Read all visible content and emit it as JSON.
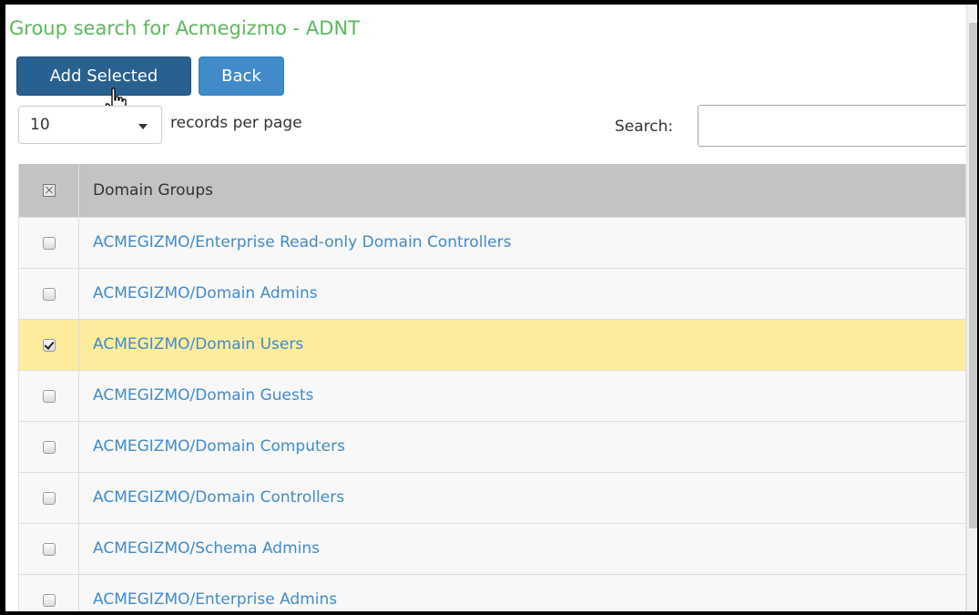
{
  "page": {
    "title": "Group search for Acmegizmo - ADNT"
  },
  "toolbar": {
    "add_selected_label": "Add Selected",
    "back_label": "Back"
  },
  "paging": {
    "length_value": "10",
    "records_label": "records per page"
  },
  "search": {
    "label": "Search:",
    "value": ""
  },
  "table": {
    "header": "Domain Groups",
    "rows": [
      {
        "name": "ACMEGIZMO/Enterprise Read-only Domain Controllers",
        "checked": false
      },
      {
        "name": "ACMEGIZMO/Domain Admins",
        "checked": false
      },
      {
        "name": "ACMEGIZMO/Domain Users",
        "checked": true
      },
      {
        "name": "ACMEGIZMO/Domain Guests",
        "checked": false
      },
      {
        "name": "ACMEGIZMO/Domain Computers",
        "checked": false
      },
      {
        "name": "ACMEGIZMO/Domain Controllers",
        "checked": false
      },
      {
        "name": "ACMEGIZMO/Schema Admins",
        "checked": false
      },
      {
        "name": "ACMEGIZMO/Enterprise Admins",
        "checked": false
      }
    ]
  },
  "colors": {
    "title": "#5cb85c",
    "primary_button": "#286090",
    "secondary_button": "#428bca",
    "link": "#428bca",
    "selected_row": "#fcec9c",
    "header_bg": "#c3c3c3"
  },
  "icons": {
    "cursor": "hand-pointer-icon",
    "dropdown": "caret-down-icon",
    "select_all": "select-all-checkbox-icon"
  }
}
